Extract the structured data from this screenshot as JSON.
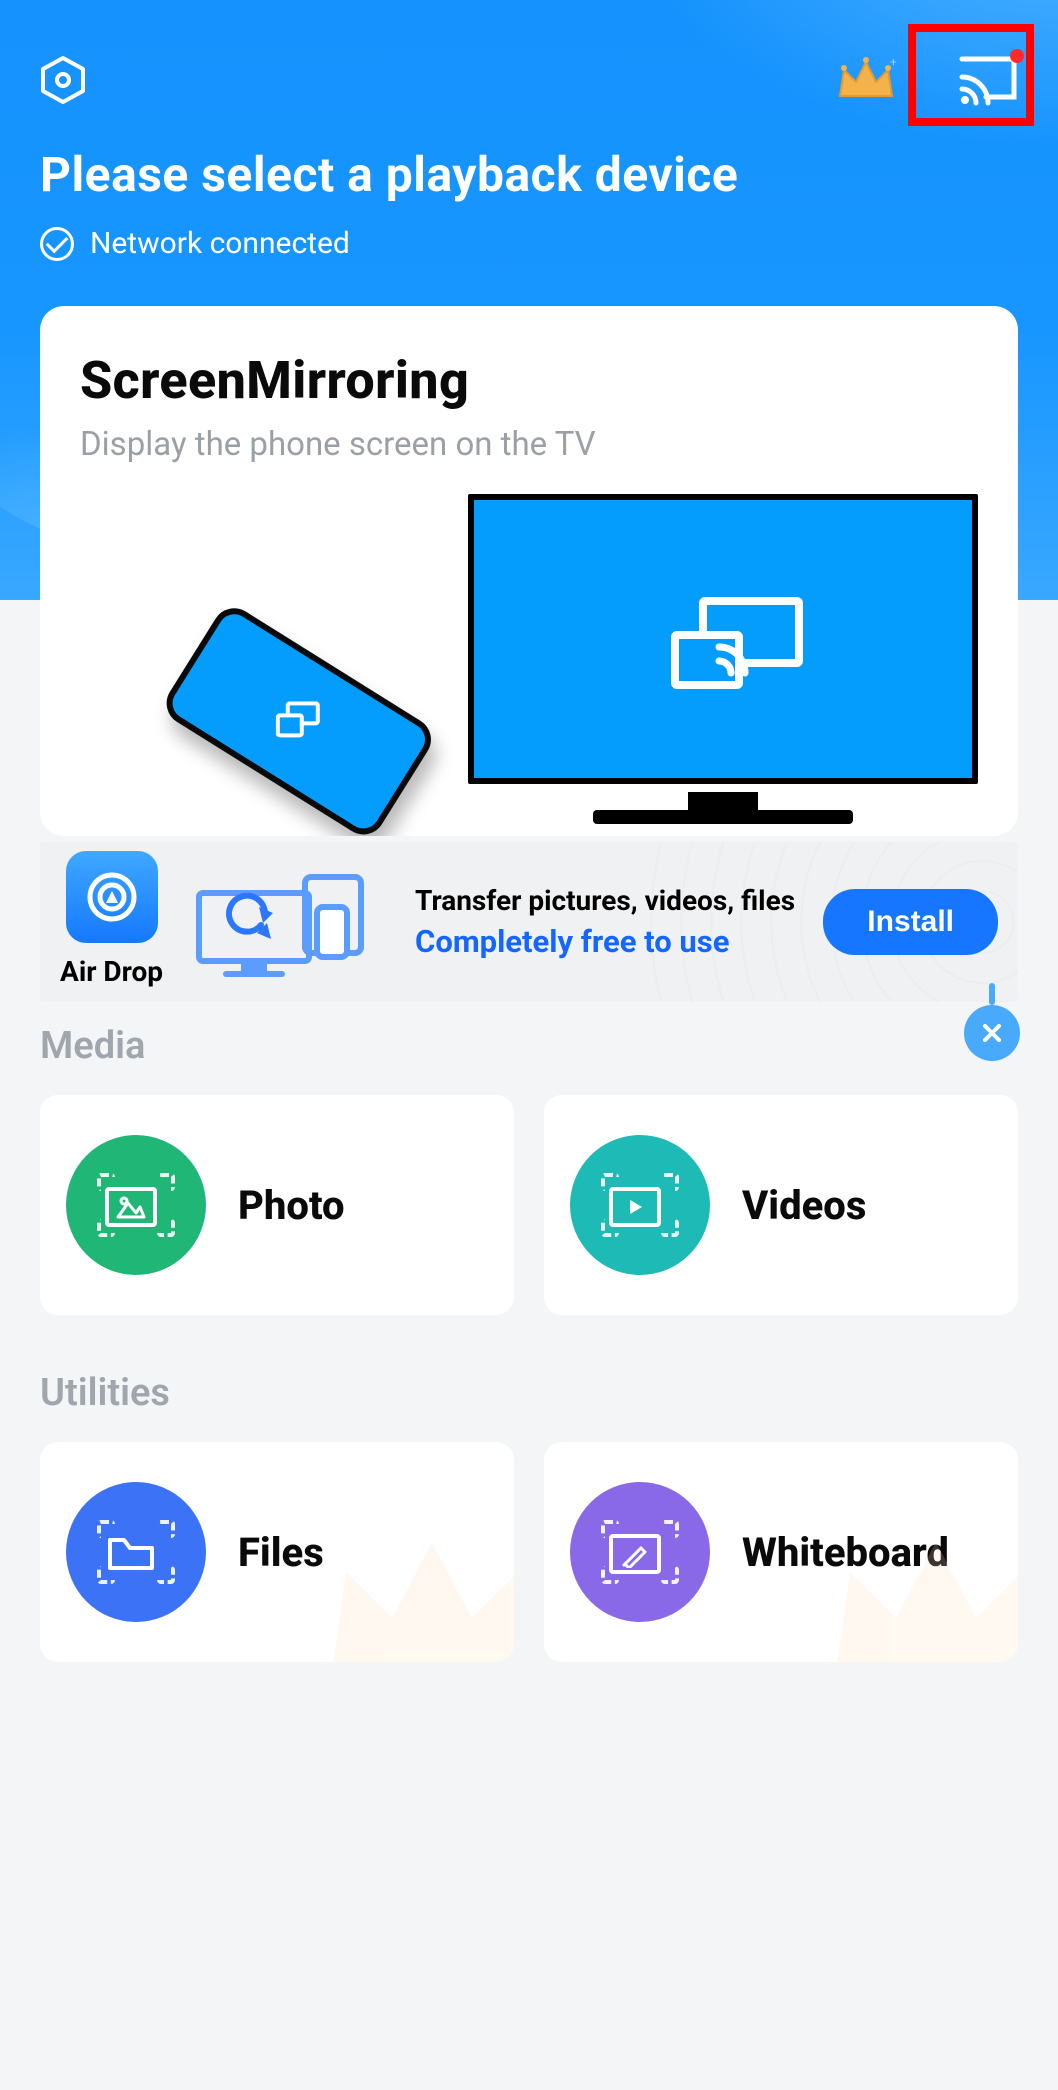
{
  "header": {
    "title": "Please select a playback device",
    "network_status": "Network connected"
  },
  "mirror_card": {
    "title": "ScreenMirroring",
    "subtitle": "Display the phone screen on the TV"
  },
  "banner": {
    "app_name": "Air Drop",
    "line1": "Transfer pictures, videos, files",
    "line2": "Completely free to use",
    "install_label": "Install"
  },
  "sections": {
    "media_label": "Media",
    "utilities_label": "Utilities"
  },
  "tiles": {
    "photo": "Photo",
    "videos": "Videos",
    "files": "Files",
    "whiteboard": "Whiteboard"
  },
  "colors": {
    "accent_blue": "#1592fd",
    "install_blue": "#1776ff",
    "link_blue": "#1366ff",
    "green": "#20b776",
    "teal": "#1dbab6",
    "blue": "#3c72f6",
    "purple": "#8a69e8",
    "highlight_red": "#ff0000"
  }
}
